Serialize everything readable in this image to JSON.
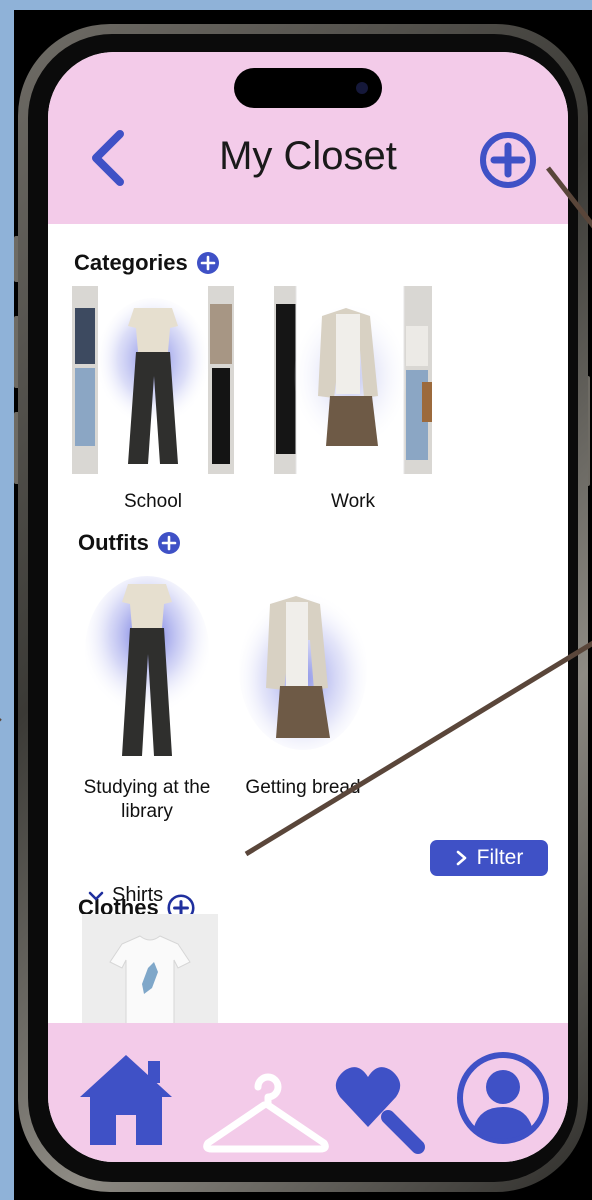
{
  "header": {
    "title": "My Closet"
  },
  "categories": {
    "title": "Categories",
    "items": [
      {
        "label": "School"
      },
      {
        "label": "Work"
      }
    ]
  },
  "outfits": {
    "title": "Outfits",
    "items": [
      {
        "label": "Studying at the library"
      },
      {
        "label": "Getting bread"
      }
    ]
  },
  "clothes": {
    "title": "Clothes",
    "filter_label": "Filter",
    "group_label": "Shirts"
  },
  "nav": {
    "items": [
      "home-icon",
      "hanger-icon",
      "heart-search-icon",
      "profile-icon"
    ]
  },
  "colors": {
    "accent": "#3f51c6",
    "header_bg": "#f3cbe9",
    "backdrop_blue": "#8fb2d8"
  }
}
